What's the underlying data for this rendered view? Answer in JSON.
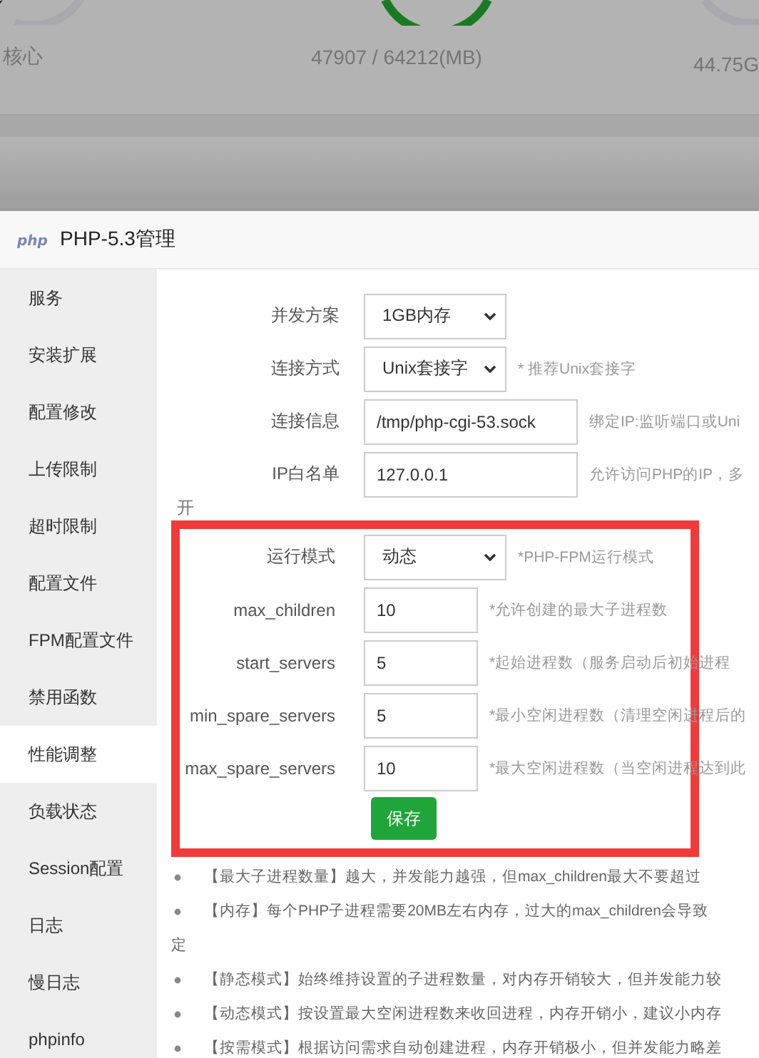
{
  "background": {
    "cpu_label": "核心",
    "memory_reading": "47907 / 64212(MB)",
    "disk_reading": "44.75G"
  },
  "dialog": {
    "logo": "php",
    "title": "PHP-5.3管理"
  },
  "sidebar": {
    "items": [
      {
        "label": "服务",
        "selected": false
      },
      {
        "label": "安装扩展",
        "selected": false
      },
      {
        "label": "配置修改",
        "selected": false
      },
      {
        "label": "上传限制",
        "selected": false
      },
      {
        "label": "超时限制",
        "selected": false
      },
      {
        "label": "配置文件",
        "selected": false
      },
      {
        "label": "FPM配置文件",
        "selected": false
      },
      {
        "label": "禁用函数",
        "selected": false
      },
      {
        "label": "性能调整",
        "selected": true
      },
      {
        "label": "负载状态",
        "selected": false
      },
      {
        "label": "Session配置",
        "selected": false
      },
      {
        "label": "日志",
        "selected": false
      },
      {
        "label": "慢日志",
        "selected": false
      },
      {
        "label": "phpinfo",
        "selected": false
      }
    ]
  },
  "form": {
    "rows": [
      {
        "kind": "select",
        "label": "并发方案",
        "value": "1GB内存"
      },
      {
        "kind": "select",
        "label": "连接方式",
        "value": "Unix套接字",
        "hint": "* 推荐Unix套接字"
      },
      {
        "kind": "wide-input",
        "label": "连接信息",
        "value": "/tmp/php-cgi-53.sock",
        "hint": "绑定IP:监听端口或Uni"
      },
      {
        "kind": "wide-input",
        "label": "IP白名单",
        "value": "127.0.0.1",
        "hint": "允许访问PHP的IP，多"
      }
    ],
    "overflow_text": "开"
  },
  "highlighted_form": {
    "rows": [
      {
        "kind": "select",
        "label": "运行模式",
        "value": "动态",
        "hint": "*PHP-FPM运行模式"
      },
      {
        "kind": "input",
        "label": "max_children",
        "value": "10",
        "hint": "*允许创建的最大子进程数"
      },
      {
        "kind": "input",
        "label": "start_servers",
        "value": "5",
        "hint": "*起始进程数（服务启动后初始进程"
      },
      {
        "kind": "input",
        "label": "min_spare_servers",
        "value": "5",
        "hint": "*最小空闲进程数（清理空闲进程后的"
      },
      {
        "kind": "input",
        "label": "max_spare_servers",
        "value": "10",
        "hint": "*最大空闲进程数（当空闲进程达到此"
      }
    ],
    "save_button": "保存"
  },
  "notes": [
    {
      "kind": "bullet",
      "text": "【最大子进程数量】越大，并发能力越强，但max_children最大不要超过"
    },
    {
      "kind": "bullet",
      "text": "【内存】每个PHP子进程需要20MB左右内存，过大的max_children会导致"
    },
    {
      "kind": "continuation",
      "text": "定"
    },
    {
      "kind": "bullet",
      "text": "【静态模式】始终维持设置的子进程数量，对内存开销较大，但并发能力较"
    },
    {
      "kind": "bullet",
      "text": "【动态模式】按设置最大空闲进程数来收回进程，内存开销小，建议小内存"
    },
    {
      "kind": "bullet",
      "text": "【按需模式】根据访问需求自动创建进程，内存开销极小，但并发能力略差"
    }
  ]
}
